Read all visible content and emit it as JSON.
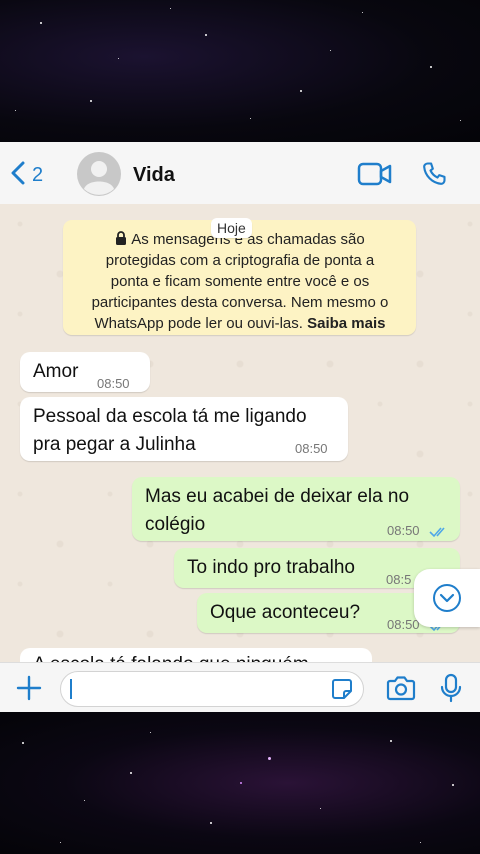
{
  "header": {
    "back_count": "2",
    "contact_name": "Vida"
  },
  "chat": {
    "day_label": "Hoje",
    "encryption": {
      "line1": "As mensagens e as chamadas são",
      "line2": "protegidas com a criptografia de ponta a",
      "line3": "ponta e ficam somente entre você e os",
      "line4": "participantes desta conversa. Nem mesmo o",
      "line5_prefix": "WhatsApp pode ler ou ouvi-las.",
      "learn_more": "Saiba mais"
    },
    "messages": [
      {
        "direction": "in",
        "lines": [
          "Amor"
        ],
        "time": "08:50"
      },
      {
        "direction": "in",
        "lines": [
          "Pessoal da escola tá me ligando",
          "pra pegar a Julinha"
        ],
        "time": "08:50"
      },
      {
        "direction": "out",
        "lines": [
          "Mas eu acabei de deixar ela no",
          "colégio"
        ],
        "time": "08:50",
        "status": "read"
      },
      {
        "direction": "out",
        "lines": [
          "To indo pro trabalho"
        ],
        "time": "08:5",
        "status": "read"
      },
      {
        "direction": "out",
        "lines": [
          "Oque aconteceu?"
        ],
        "time": "08:50",
        "status": "read"
      }
    ],
    "partial_message": "A escola tá falando que ninguém buscou"
  },
  "icons": {
    "back": "chevron-left-icon",
    "avatar": "default-avatar-icon",
    "video": "video-camera-icon",
    "call": "phone-icon",
    "scroll": "chevron-down-circle-icon",
    "attach": "plus-icon",
    "sticker": "sticker-icon",
    "camera": "camera-icon",
    "mic": "microphone-icon"
  },
  "colors": {
    "accent": "#1f7ecb",
    "incoming_bubble": "#ffffff",
    "outgoing_bubble": "#dcf8c6",
    "encryption_notice": "#fdf3c4",
    "chat_background": "#efe7dd"
  }
}
